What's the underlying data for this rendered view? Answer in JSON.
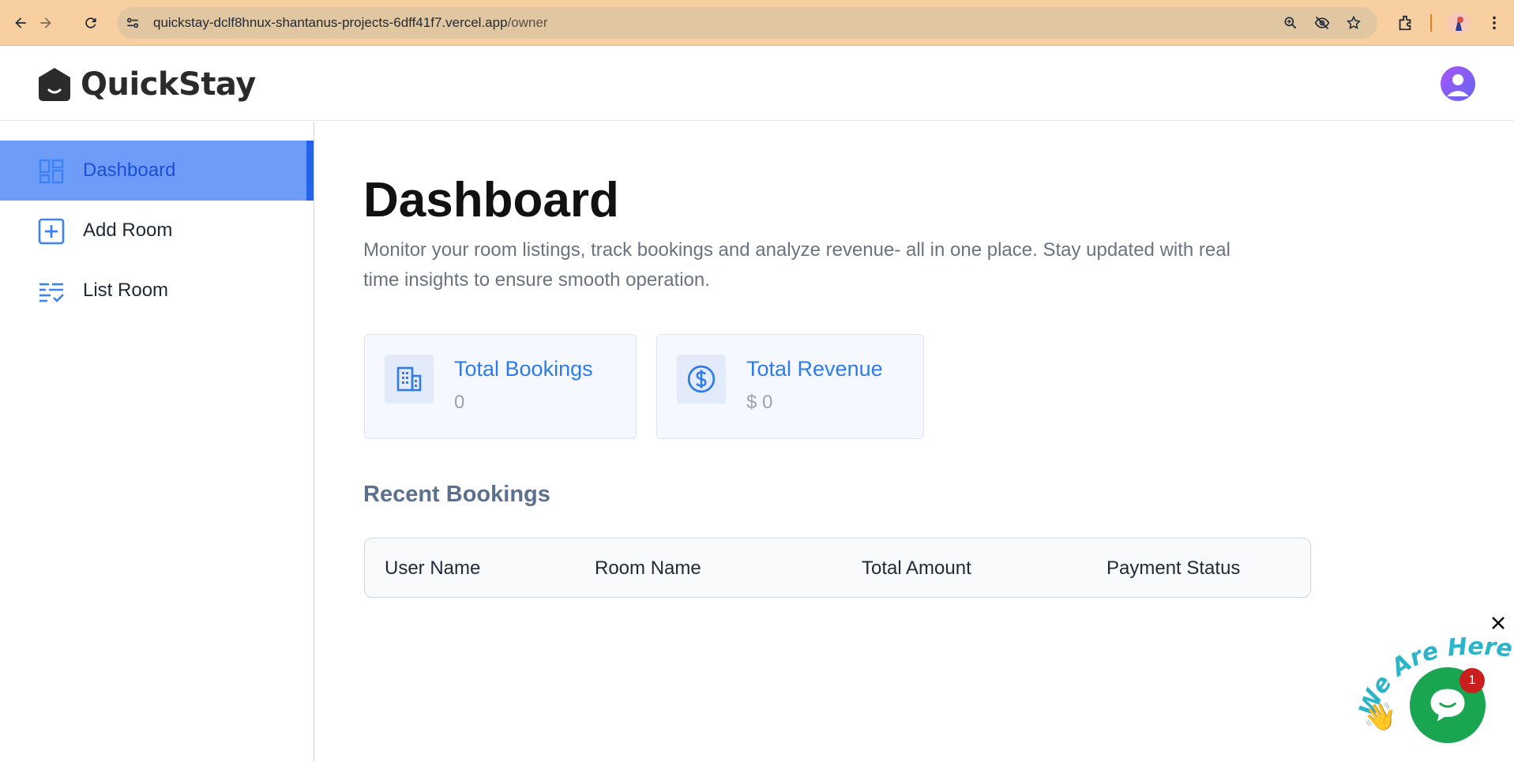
{
  "browser": {
    "url_host": "quickstay-dclf8hnux-shantanus-projects-6dff41f7.vercel.app",
    "url_path": "/owner",
    "icons": [
      "back-icon",
      "forward-icon",
      "reload-icon",
      "site-info-icon",
      "zoom-icon",
      "eye-off-icon",
      "star-icon",
      "extensions-icon",
      "profile-icon",
      "more-icon"
    ]
  },
  "header": {
    "brand": "QuickStay"
  },
  "sidebar": {
    "items": [
      {
        "label": "Dashboard",
        "icon": "dashboard-icon",
        "active": true
      },
      {
        "label": "Add Room",
        "icon": "add-box-icon",
        "active": false
      },
      {
        "label": "List Room",
        "icon": "list-check-icon",
        "active": false
      }
    ]
  },
  "main": {
    "title": "Dashboard",
    "description": "Monitor your room listings, track bookings and analyze revenue- all in one place. Stay updated with real time insights to ensure smooth operation.",
    "stats": [
      {
        "title": "Total Bookings",
        "value": "0",
        "icon": "building-icon"
      },
      {
        "title": "Total Revenue",
        "value": "$ 0",
        "icon": "dollar-icon"
      }
    ],
    "recent_title": "Recent Bookings",
    "table_headers": [
      "User Name",
      "Room Name",
      "Total Amount",
      "Payment Status"
    ]
  },
  "chat_widget": {
    "ribbon_text": "We Are Here!",
    "badge_count": "1",
    "emoji": "👋"
  },
  "colors": {
    "accent": "#2563eb",
    "active_bg": "#6f9cf9",
    "chat_green": "#1aa550",
    "browser_bar": "#f7cfa0"
  }
}
